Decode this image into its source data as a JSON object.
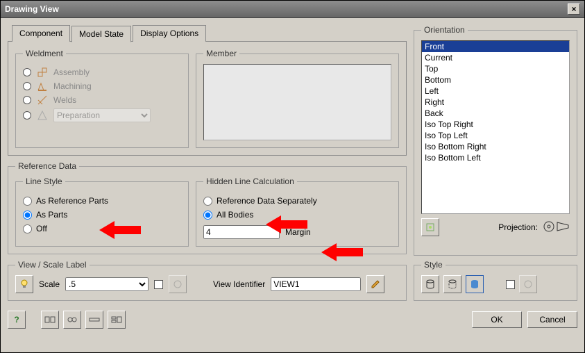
{
  "window": {
    "title": "Drawing View"
  },
  "tabs": {
    "t0": "Component",
    "t1": "Model State",
    "t2": "Display Options",
    "active": 1
  },
  "weldment": {
    "legend": "Weldment",
    "opt0": "Assembly",
    "opt1": "Machining",
    "opt2": "Welds",
    "opt3select": "Preparation"
  },
  "member": {
    "legend": "Member"
  },
  "refdata": {
    "legend": "Reference Data"
  },
  "linestyle": {
    "legend": "Line Style",
    "opt0": "As Reference Parts",
    "opt1": "As Parts",
    "opt2": "Off",
    "selected": 1
  },
  "hidden": {
    "legend": "Hidden Line Calculation",
    "opt0": "Reference Data Separately",
    "opt1": "All Bodies",
    "selected": 1,
    "margin_value": "4",
    "margin_label": "Margin"
  },
  "orientation": {
    "legend": "Orientation",
    "items": [
      "Front",
      "Current",
      "Top",
      "Bottom",
      "Left",
      "Right",
      "Back",
      "Iso Top Right",
      "Iso Top Left",
      "Iso Bottom Right",
      "Iso Bottom Left"
    ],
    "selected": 0,
    "projection_label": "Projection:"
  },
  "viewscale": {
    "legend": "View / Scale Label",
    "scale_label": "Scale",
    "scale_value": ".5",
    "id_label": "View Identifier",
    "id_value": "VIEW1"
  },
  "style": {
    "legend": "Style"
  },
  "buttons": {
    "ok": "OK",
    "cancel": "Cancel"
  }
}
